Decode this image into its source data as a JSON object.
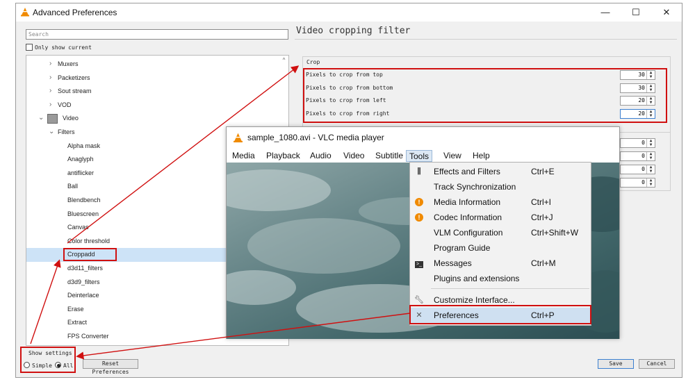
{
  "window": {
    "title": "Advanced Preferences",
    "controls": {
      "minimize": "—",
      "maximize": "☐",
      "close": "✕"
    }
  },
  "left_panel": {
    "search_placeholder": "Search",
    "only_show_current": "Only show current",
    "tree": [
      {
        "label": "Muxers",
        "chevron": "›"
      },
      {
        "label": "Packetizers",
        "chevron": "›"
      },
      {
        "label": "Sout stream",
        "chevron": "›"
      },
      {
        "label": "VOD",
        "chevron": "›"
      },
      {
        "label": "Video",
        "chevron": "⌄"
      },
      {
        "label": "Filters",
        "chevron": "⌄"
      },
      {
        "label": "Alpha mask"
      },
      {
        "label": "Anaglyph"
      },
      {
        "label": "antiflicker"
      },
      {
        "label": "Ball"
      },
      {
        "label": "Blendbench"
      },
      {
        "label": "Bluescreen"
      },
      {
        "label": "Canvas"
      },
      {
        "label": "Color threshold"
      },
      {
        "label": "Croppadd"
      },
      {
        "label": "d3d11_filters"
      },
      {
        "label": "d3d9_filters"
      },
      {
        "label": "Deinterlace"
      },
      {
        "label": "Erase"
      },
      {
        "label": "Extract"
      },
      {
        "label": "FPS Converter"
      }
    ],
    "show_settings": {
      "label": "Show settings",
      "simple": "Simple",
      "all": "All"
    },
    "reset_button": "Reset Preferences"
  },
  "right_panel": {
    "heading": "Video cropping filter",
    "crop_group": "Crop",
    "crop_options": [
      {
        "label": "Pixels to crop from top",
        "value": "30"
      },
      {
        "label": "Pixels to crop from bottom",
        "value": "30"
      },
      {
        "label": "Pixels to crop from left",
        "value": "20"
      },
      {
        "label": "Pixels to crop from right",
        "value": "20"
      }
    ],
    "pad_values": [
      "0",
      "0",
      "0",
      "0"
    ],
    "save": "Save",
    "cancel": "Cancel"
  },
  "vlc": {
    "title": "sample_1080.avi - VLC media player",
    "menus": [
      "Media",
      "Playback",
      "Audio",
      "Video",
      "Subtitle",
      "Tools",
      "View",
      "Help"
    ],
    "tools_menu": [
      {
        "label": "Effects and Filters",
        "shortcut": "Ctrl+E",
        "icon": "equalizer-icon"
      },
      {
        "label": "Track Synchronization",
        "shortcut": "",
        "icon": ""
      },
      {
        "label": "Media Information",
        "shortcut": "Ctrl+I",
        "icon": "info-icon"
      },
      {
        "label": "Codec Information",
        "shortcut": "Ctrl+J",
        "icon": "info-icon"
      },
      {
        "label": "VLM Configuration",
        "shortcut": "Ctrl+Shift+W",
        "icon": ""
      },
      {
        "label": "Program Guide",
        "shortcut": "",
        "icon": ""
      },
      {
        "label": "Messages",
        "shortcut": "Ctrl+M",
        "icon": "terminal-icon"
      },
      {
        "label": "Plugins and extensions",
        "shortcut": "",
        "icon": ""
      },
      {
        "label": "Customize Interface...",
        "shortcut": "",
        "icon": "wrench-icon"
      },
      {
        "label": "Preferences",
        "shortcut": "Ctrl+P",
        "icon": "tools-icon"
      }
    ]
  },
  "colors": {
    "highlight_box": "#d01010",
    "vlc_orange": "#f08a00"
  }
}
